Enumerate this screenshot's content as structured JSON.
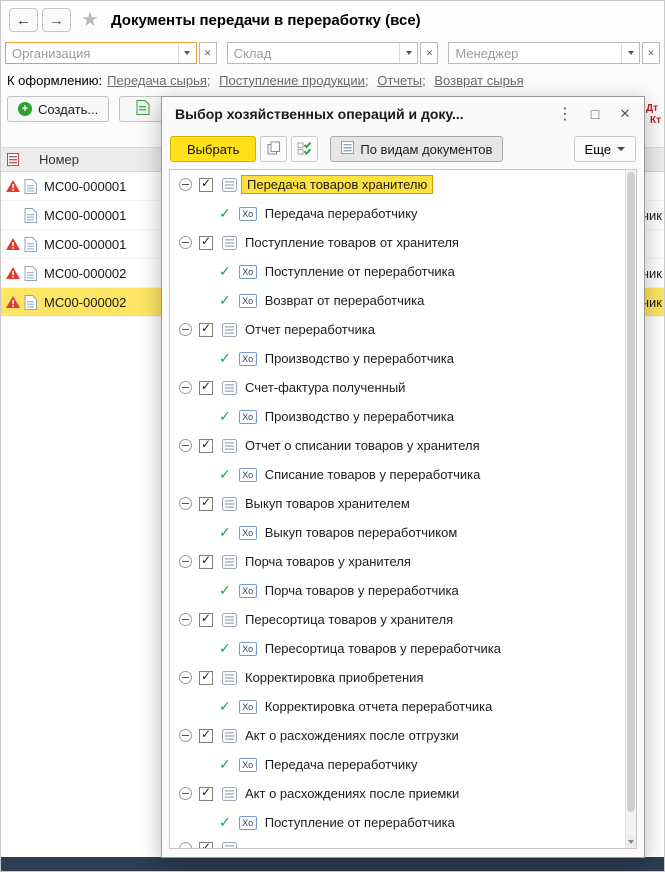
{
  "navbar": {
    "title": "Документы передачи в переработку (все)"
  },
  "filters": [
    {
      "placeholder": "Организация",
      "value": "",
      "focused": true
    },
    {
      "placeholder": "Склад",
      "value": ""
    },
    {
      "placeholder": "Менеджер",
      "value": ""
    }
  ],
  "links_row": {
    "label": "К оформлению:",
    "separator": ";",
    "links": [
      "Передача сырья",
      "Поступление продукции",
      "Отчеты",
      "Возврат сырья"
    ]
  },
  "toolbar": {
    "create_label": "Создать...",
    "dt": "Дт",
    "kt": "Кт"
  },
  "table": {
    "number_column": "Номер",
    "rows": [
      {
        "number": "МС00-000001",
        "warning": true,
        "fragment": ""
      },
      {
        "number": "МС00-000001",
        "warning": false,
        "fragment": "чик"
      },
      {
        "number": "МС00-000001",
        "warning": true,
        "fragment": ""
      },
      {
        "number": "МС00-000002",
        "warning": true,
        "fragment": "чик"
      },
      {
        "number": "МС00-000002",
        "warning": true,
        "selected": true,
        "fragment": "чик"
      }
    ]
  },
  "dialog": {
    "title": "Выбор хозяйственных операций и доку...",
    "select_button": "Выбрать",
    "view_toggle": "По видам документов",
    "more_button": "Еще",
    "ho_badge": "Хо",
    "rows": [
      {
        "kind": "group",
        "label": "Передача товаров хранителю",
        "selected": true,
        "checked": true
      },
      {
        "kind": "leaf",
        "label": "Передача переработчику"
      },
      {
        "kind": "group",
        "label": "Поступление товаров от хранителя",
        "checked": true
      },
      {
        "kind": "leaf",
        "label": "Поступление от переработчика"
      },
      {
        "kind": "leaf",
        "label": "Возврат от переработчика"
      },
      {
        "kind": "group",
        "label": "Отчет переработчика",
        "checked": true
      },
      {
        "kind": "leaf",
        "label": "Производство у переработчика"
      },
      {
        "kind": "group",
        "label": "Счет-фактура полученный",
        "checked": true
      },
      {
        "kind": "leaf",
        "label": "Производство у переработчика"
      },
      {
        "kind": "group",
        "label": "Отчет о списании товаров у хранителя",
        "checked": true
      },
      {
        "kind": "leaf",
        "label": "Списание товаров у переработчика"
      },
      {
        "kind": "group",
        "label": "Выкуп товаров хранителем",
        "checked": true
      },
      {
        "kind": "leaf",
        "label": "Выкуп товаров переработчиком"
      },
      {
        "kind": "group",
        "label": "Порча товаров у хранителя",
        "checked": true
      },
      {
        "kind": "leaf",
        "label": "Порча товаров у переработчика"
      },
      {
        "kind": "group",
        "label": "Пересортица товаров у хранителя",
        "checked": true
      },
      {
        "kind": "leaf",
        "label": "Пересортица товаров у переработчика"
      },
      {
        "kind": "group",
        "label": "Корректировка приобретения",
        "checked": true
      },
      {
        "kind": "leaf",
        "label": "Корректировка отчета переработчика"
      },
      {
        "kind": "group",
        "label": "Акт о расхождениях после отгрузки",
        "checked": true
      },
      {
        "kind": "leaf",
        "label": "Передача переработчику"
      },
      {
        "kind": "group",
        "label": "Акт о расхождениях после приемки",
        "checked": true
      },
      {
        "kind": "leaf",
        "label": "Поступление от переработчика"
      },
      {
        "kind": "group",
        "label": "",
        "partial": true,
        "checked": true
      }
    ]
  },
  "colors": {
    "accent_yellow": "#ffe11a",
    "selection_yellow": "#ffe564",
    "warning_red": "#e23c2e",
    "leaf_check_green": "#17a23b",
    "bottom_bar": "#2e3d52",
    "debit_credit_red": "#c11c1c"
  }
}
